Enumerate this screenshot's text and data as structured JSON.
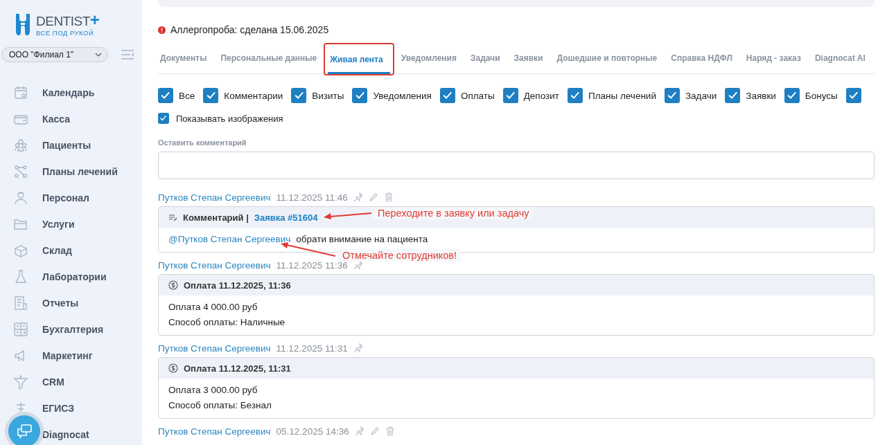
{
  "logo": {
    "name": "DENTIST",
    "mark": "+",
    "tagline": "ВСЕ ПОД РУКОЙ"
  },
  "branch_select": {
    "value": "ООО \"Филиал 1\""
  },
  "sidebar": {
    "items": [
      {
        "label": "Календарь"
      },
      {
        "label": "Касса"
      },
      {
        "label": "Пациенты"
      },
      {
        "label": "Планы лечений"
      },
      {
        "label": "Персонал"
      },
      {
        "label": "Услуги"
      },
      {
        "label": "Склад"
      },
      {
        "label": "Лаборатории"
      },
      {
        "label": "Отчеты"
      },
      {
        "label": "Бухгалтерия"
      },
      {
        "label": "Маркетинг"
      },
      {
        "label": "CRM"
      },
      {
        "label": "ЕГИСЗ"
      },
      {
        "label": "Diagnocat"
      }
    ]
  },
  "alert": {
    "text": "Аллергопроба: сделана 15.06.2025"
  },
  "tabs": [
    {
      "label": "Документы",
      "selected": false
    },
    {
      "label": "Персональные данные",
      "selected": false
    },
    {
      "label": "Живая лента",
      "selected": true
    },
    {
      "label": "Уведомления",
      "selected": false
    },
    {
      "label": "Задачи",
      "selected": false
    },
    {
      "label": "Заявки",
      "selected": false
    },
    {
      "label": "Дошедшие и повторные",
      "selected": false
    },
    {
      "label": "Справка НДФЛ",
      "selected": false
    },
    {
      "label": "Наряд - заказ",
      "selected": false
    },
    {
      "label": "Diagnocat AI",
      "selected": false
    }
  ],
  "filters": [
    {
      "label": "Все",
      "checked": true
    },
    {
      "label": "Комментарии",
      "checked": true
    },
    {
      "label": "Визиты",
      "checked": true
    },
    {
      "label": "Уведомления",
      "checked": true
    },
    {
      "label": "Оплаты",
      "checked": true
    },
    {
      "label": "Депозит",
      "checked": true
    },
    {
      "label": "Планы лечений",
      "checked": true
    },
    {
      "label": "Задачи",
      "checked": true
    },
    {
      "label": "Заявки",
      "checked": true
    },
    {
      "label": "Бонусы",
      "checked": true
    },
    {
      "checked": true
    }
  ],
  "show_images": {
    "label": "Показывать изображения",
    "checked": true
  },
  "comment_field": {
    "label": "Оставить комментарий"
  },
  "feed": [
    {
      "author": "Путков Степан Сергеевич",
      "time": "11.12.2025 11:46",
      "editable": true,
      "card": {
        "kind": "comment",
        "title": "Комментарий |",
        "link": "Заявка #51604",
        "mention": "@Путков Степан Сергеевич",
        "text": "обрати внимание на пациента"
      }
    },
    {
      "author": "Путков Степан Сергеевич",
      "time": "11.12.2025 11:36",
      "editable": false,
      "card": {
        "kind": "payment",
        "title": "Оплата 11.12.2025, 11:36",
        "lines": [
          "Оплата 4 000.00 руб",
          "Способ оплаты: Наличные"
        ]
      }
    },
    {
      "author": "Путков Степан Сергеевич",
      "time": "11.12.2025 11:31",
      "editable": false,
      "card": {
        "kind": "payment",
        "title": "Оплата 11.12.2025, 11:31",
        "lines": [
          "Оплата 3 000.00 руб",
          "Способ оплаты: Безнал"
        ]
      }
    },
    {
      "author": "Путков Степан Сергеевич",
      "time": "05.12.2025 14:36",
      "editable": true
    }
  ],
  "annotations": [
    {
      "text": "Переходите в заявку или задачу"
    },
    {
      "text": "Отмечайте сотрудников!"
    }
  ]
}
